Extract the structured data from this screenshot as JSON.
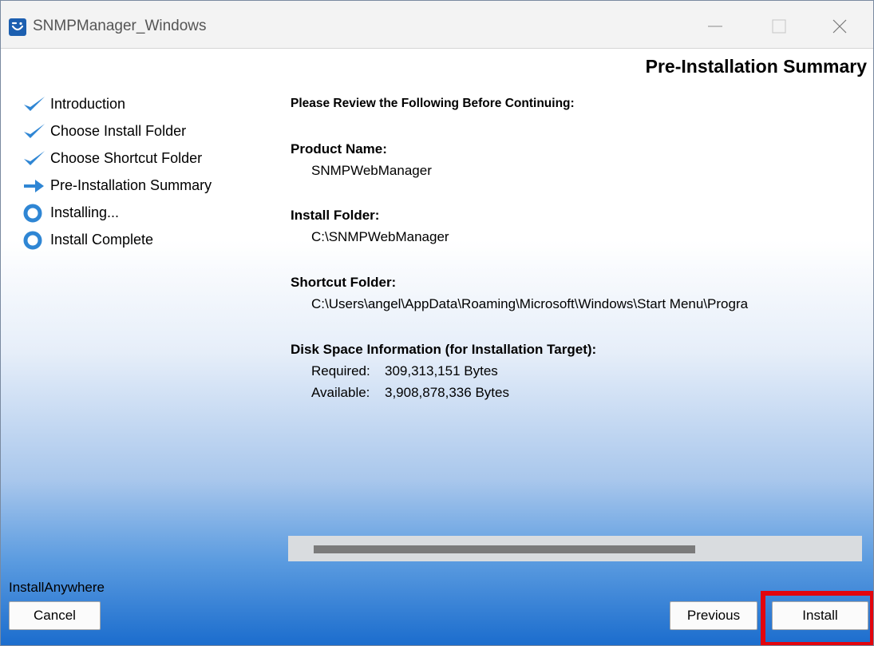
{
  "window": {
    "title": "SNMPManager_Windows",
    "controls": {
      "minimize_icon": "minimize-icon",
      "maximize_icon": "maximize-icon",
      "close_icon": "close-icon"
    }
  },
  "heading": "Pre-Installation Summary",
  "sidebar": {
    "steps": [
      {
        "label": "Introduction",
        "status": "done",
        "icon": "checkmark-icon"
      },
      {
        "label": "Choose Install Folder",
        "status": "done",
        "icon": "checkmark-icon"
      },
      {
        "label": "Choose Shortcut Folder",
        "status": "done",
        "icon": "checkmark-icon"
      },
      {
        "label": "Pre-Installation Summary",
        "status": "current",
        "icon": "arrow-right-icon"
      },
      {
        "label": "Installing...",
        "status": "pending",
        "icon": "circle-icon"
      },
      {
        "label": "Install Complete",
        "status": "pending",
        "icon": "circle-icon"
      }
    ]
  },
  "summary": {
    "intro": "Please Review the Following Before Continuing:",
    "product_name": {
      "title": "Product Name:",
      "value": "SNMPWebManager"
    },
    "install_folder": {
      "title": "Install Folder:",
      "value": "C:\\SNMPWebManager"
    },
    "shortcut_folder": {
      "title": "Shortcut Folder:",
      "value": "C:\\Users\\angel\\AppData\\Roaming\\Microsoft\\Windows\\Start Menu\\Progra"
    },
    "disk_space": {
      "title": "Disk Space Information (for Installation Target):",
      "required_label": "Required:",
      "required_value": "309,313,151 Bytes",
      "available_label": "Available:",
      "available_value": "3,908,878,336 Bytes"
    }
  },
  "scrollbar": {
    "thumb_fraction": 0.73
  },
  "footer": {
    "brand": "InstallAnywhere",
    "cancel_label": "Cancel",
    "previous_label": "Previous",
    "install_label": "Install"
  },
  "colors": {
    "check": "#2f86d4",
    "highlight": "#e3050d",
    "titlebar": "#f3f3f3"
  }
}
